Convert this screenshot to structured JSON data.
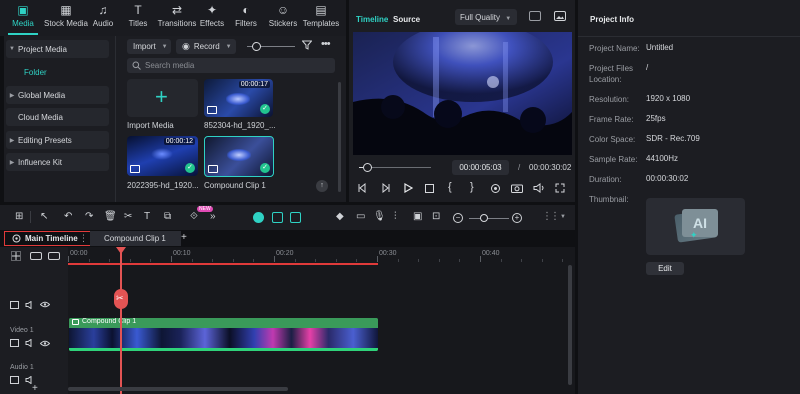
{
  "toolbar": [
    {
      "label": "Media",
      "icon": "media-icon",
      "active": true
    },
    {
      "label": "Stock Media",
      "icon": "stock-media-icon"
    },
    {
      "label": "Audio",
      "icon": "audio-icon"
    },
    {
      "label": "Titles",
      "icon": "titles-icon"
    },
    {
      "label": "Transitions",
      "icon": "transitions-icon"
    },
    {
      "label": "Effects",
      "icon": "effects-icon"
    },
    {
      "label": "Filters",
      "icon": "filters-icon"
    },
    {
      "label": "Stickers",
      "icon": "stickers-icon"
    },
    {
      "label": "Templates",
      "icon": "templates-icon"
    }
  ],
  "sidebar": {
    "project_media": "Project Media",
    "folder": "Folder",
    "global_media": "Global Media",
    "cloud_media": "Cloud Media",
    "editing_presets": "Editing Presets",
    "influence_kit": "Influence Kit"
  },
  "media": {
    "import_btn": "Import",
    "record_btn": "Record",
    "search_placeholder": "Search media",
    "import_media_label": "Import Media",
    "items": [
      {
        "name": "852304-hd_1920_...",
        "duration": "00:00:17"
      },
      {
        "name": "2022395-hd_1920...",
        "duration": "00:00:12"
      },
      {
        "name": "Compound Clip 1",
        "duration": ""
      }
    ]
  },
  "player": {
    "tab_timeline": "Timeline",
    "tab_source": "Source",
    "quality": "Full Quality",
    "current_time": "00:00:05:03",
    "separator": "/",
    "total_time": "00:00:30:02",
    "progress": 0.06
  },
  "project_info": {
    "title": "Project Info",
    "rows": [
      {
        "k": "Project Name:",
        "v": "Untitled"
      },
      {
        "k": "Project Files Location:",
        "v": "/"
      },
      {
        "k": "Resolution:",
        "v": "1920 x 1080"
      },
      {
        "k": "Frame Rate:",
        "v": "25fps"
      },
      {
        "k": "Color Space:",
        "v": "SDR - Rec.709"
      },
      {
        "k": "Sample Rate:",
        "v": "44100Hz"
      },
      {
        "k": "Duration:",
        "v": "00:00:30:02"
      },
      {
        "k": "Thumbnail:",
        "v": ""
      }
    ],
    "edit_btn": "Edit",
    "thumb_text": "AI"
  },
  "timeline": {
    "tab_main": "Main Timeline",
    "tab_compound": "Compound Clip 1",
    "add_tab": "+",
    "new_badge": "NEW",
    "ticks": [
      "00:00",
      "00:10",
      "00:20",
      "00:30",
      "00:40"
    ],
    "clip_label": "Compound Clip 1",
    "video_track": "Video 1",
    "audio_track": "Audio 1"
  }
}
